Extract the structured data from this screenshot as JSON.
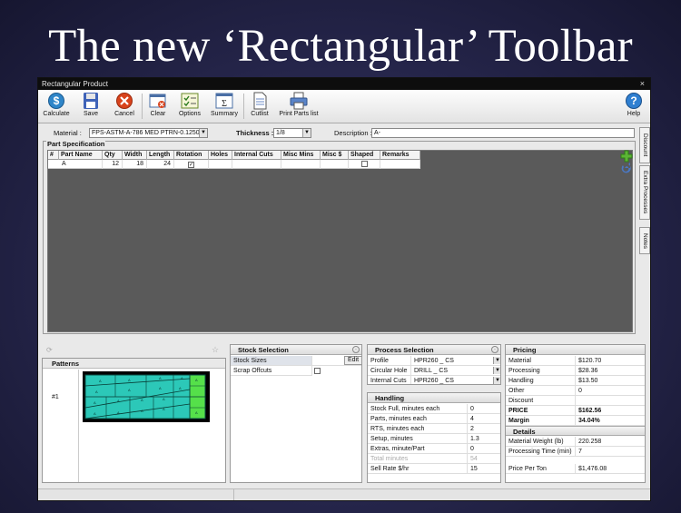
{
  "slide_title": "The new ‘Rectangular’ Toolbar",
  "window": {
    "title": "Rectangular Product",
    "close": "×"
  },
  "toolbar": {
    "calculate": "Calculate",
    "save": "Save",
    "cancel": "Cancel",
    "clear": "Clear",
    "options": "Options",
    "summary": "Summary",
    "cutlist": "Cutlist",
    "print_parts": "Print Parts list",
    "help": "Help"
  },
  "fields": {
    "material_label": "Material :",
    "material_value": "FPS-ASTM-A-786 MED PTRN-0.1250",
    "thickness_label": "Thickness :",
    "thickness_value": "1/8",
    "description_label": "Description :",
    "description_value": "A-"
  },
  "part_spec": {
    "title": "Part Specification",
    "columns": [
      "#",
      "Part Name",
      "Qty",
      "Width",
      "Length",
      "Rotation",
      "Holes",
      "Internal Cuts",
      "Misc Mins",
      "Misc $",
      "Shaped",
      "Remarks"
    ],
    "row": {
      "part_name": "A",
      "qty": "12",
      "width": "18",
      "length": "24",
      "rotation_check": "✓",
      "shaped_check": ""
    }
  },
  "side_tabs": {
    "discount": "Discount",
    "extra_processes": "Extra Processes",
    "notes": "Notes"
  },
  "patterns": {
    "title": "Patterns",
    "number": "#1",
    "tile_labels": [
      "A",
      "A",
      "A",
      "A",
      "A",
      "A",
      "A",
      "A",
      "A",
      "A",
      "A",
      "A",
      "A",
      "A",
      "A",
      "A",
      "A",
      "A"
    ]
  },
  "stock_selection": {
    "title": "Stock Selection",
    "stock_sizes": "Stock Sizes",
    "edit": "Edit",
    "scrap_offcuts": "Scrap Offcuts"
  },
  "process_selection": {
    "title": "Process Selection",
    "rows": [
      {
        "label": "Profile",
        "value": "HPR260 _ CS"
      },
      {
        "label": "Circular Hole",
        "value": "DRILL _ CS"
      },
      {
        "label": "Internal Cuts",
        "value": "HPR260 _ CS"
      }
    ]
  },
  "handling": {
    "title": "Handling",
    "rows": [
      {
        "label": "Stock Full, minutes each",
        "value": "0"
      },
      {
        "label": "Parts, minutes each",
        "value": "4"
      },
      {
        "label": "RTS, minutes each",
        "value": "2"
      },
      {
        "label": "Setup, minutes",
        "value": "1.3"
      },
      {
        "label": "Extras, minute/Part",
        "value": "0"
      },
      {
        "label": "Total minutes",
        "value": "54"
      },
      {
        "label": "Sell Rate $/hr",
        "value": "15"
      }
    ]
  },
  "pricing": {
    "title": "Pricing",
    "rows": [
      {
        "label": "Material",
        "value": "$120.70"
      },
      {
        "label": "Processing",
        "value": "$28.36"
      },
      {
        "label": "Handling",
        "value": "$13.50"
      },
      {
        "label": "Other",
        "value": "0"
      },
      {
        "label": "Discount",
        "value": ""
      },
      {
        "label": "PRICE",
        "value": "$162.56"
      },
      {
        "label": "Margin",
        "value": "34.04%"
      }
    ],
    "details_title": "Details",
    "details": [
      {
        "label": "Material Weight (lb)",
        "value": "220.258"
      },
      {
        "label": "Processing Time (min)",
        "value": "7"
      }
    ],
    "price_per_ton_label": "Price Per Ton",
    "price_per_ton_value": "$1,476.08"
  },
  "colors": {
    "accent_green": "#4caf50",
    "nest_tile": "#2cc8b8",
    "nest_bg": "#000000",
    "window_bg": "#e9e9e9"
  }
}
